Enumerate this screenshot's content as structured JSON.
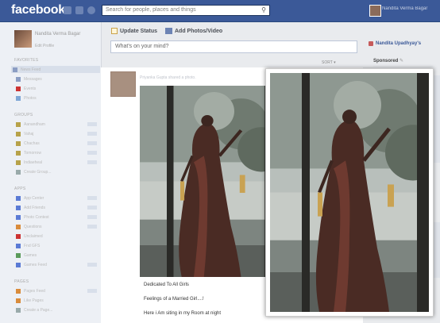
{
  "topbar": {
    "logo": "facebook",
    "search_placeholder": "Search for people, places and things",
    "user_name": "Nandita Verma Bagar"
  },
  "left": {
    "profile_name": "Nandita Verma Bagar",
    "edit_label": "Edit Profile",
    "favorites_header": "FAVORITES",
    "favorites": [
      "News Feed",
      "Messages",
      "Events",
      "Photos"
    ],
    "groups_header": "GROUPS",
    "groups": [
      "Aanandham",
      "Vahaj",
      "Chachas",
      "Tomorrow",
      "Indiaeheal",
      "Create Group..."
    ],
    "apps_header": "APPS",
    "apps": [
      "App Center",
      "Add Friends",
      "Photo Contest",
      "Questions",
      "Unclaimed",
      "Fnd GFS",
      "Games",
      "Games Feed"
    ],
    "pages_header": "PAGES",
    "pages": [
      "Pages Feed",
      "Like Pages",
      "Create a Page..."
    ]
  },
  "composer": {
    "update_status": "Update Status",
    "add_photos": "Add Photos/Video",
    "placeholder": "What's on your mind?",
    "sort": "SORT"
  },
  "post": {
    "author": "Priyanka Gupta shared a photo.",
    "captions": [
      "Dedicated To All Girls",
      "Feelings of a Married Girl....!",
      "Here i Am siting in my Room at night"
    ]
  },
  "right": {
    "user": "Nandita Upadhyay's",
    "sponsored": "Sponsored"
  },
  "colors": {
    "brand": "#3b5998",
    "background": "#e9ebee"
  }
}
